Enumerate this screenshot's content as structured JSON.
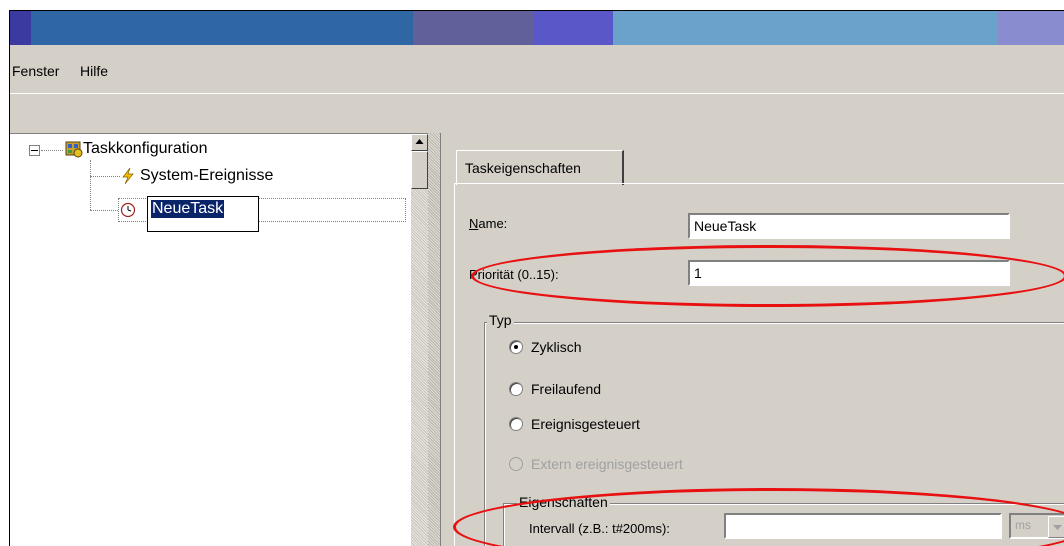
{
  "colors": {
    "title_segments": [
      "#3a3aa0",
      "#2f66a4",
      "#62609a",
      "#5a58c8",
      "#6aa2cc",
      "#8a8cd0"
    ],
    "highlight_ring": "#e81010",
    "selection_bg": "#0a246a"
  },
  "menu": {
    "items": [
      "Fenster",
      "Hilfe"
    ]
  },
  "tree": {
    "root": {
      "label": "Taskkonfiguration",
      "icon": "task-config-icon",
      "expander": "⊟"
    },
    "children": [
      {
        "label": "System-Ereignisse",
        "icon": "lightning-icon"
      },
      {
        "label": "NeueTask",
        "icon": "clock-icon",
        "editing": true
      }
    ]
  },
  "tabs": [
    "Taskeigenschaften"
  ],
  "form": {
    "name_label": "Name:",
    "name_value": "NeueTask",
    "priority_label": "Priorität (0..15):",
    "priority_value": "1",
    "type_group_title": "Typ",
    "radios": [
      {
        "label": "Zyklisch",
        "checked": true,
        "enabled": true
      },
      {
        "label": "Freilaufend",
        "checked": false,
        "enabled": true
      },
      {
        "label": "Ereignisgesteuert",
        "checked": false,
        "enabled": true
      },
      {
        "label": "Extern ereignisgesteuert",
        "checked": false,
        "enabled": false
      }
    ],
    "props_group_title": "Eigenschaften",
    "interval_label": "Intervall (z.B.: t#200ms):",
    "interval_value": "",
    "unit_value": "ms"
  }
}
